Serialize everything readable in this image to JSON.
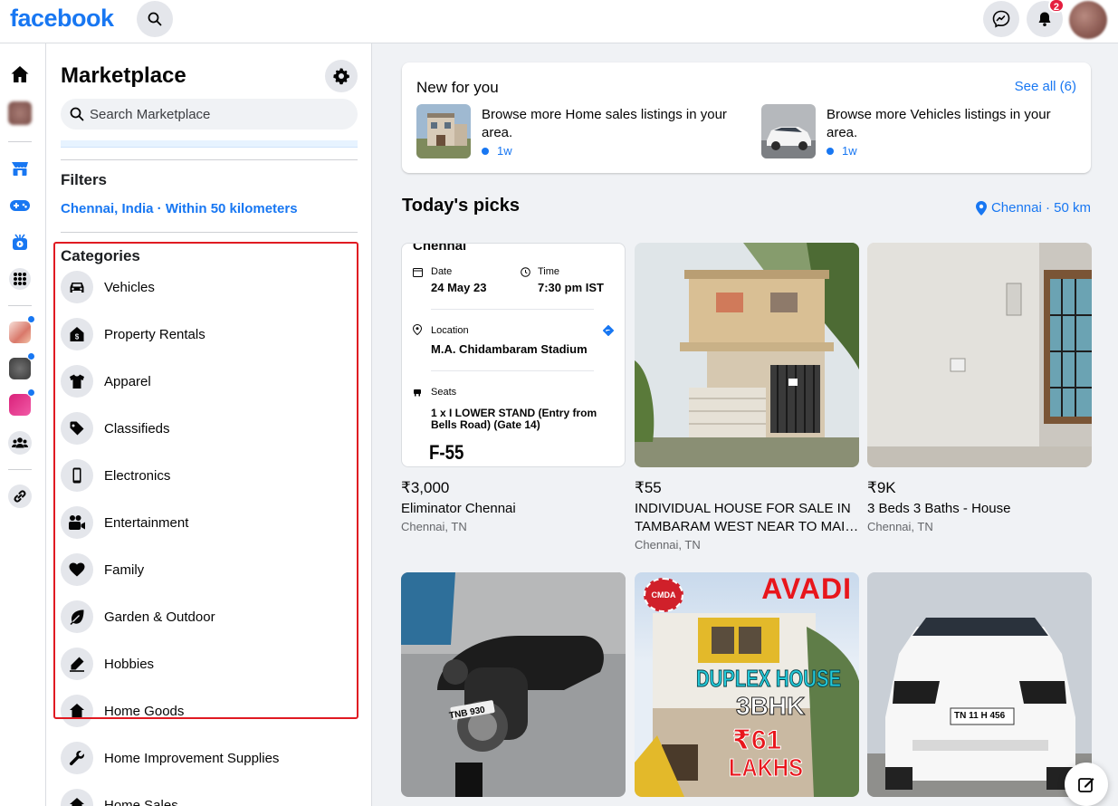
{
  "header": {
    "logo": "facebook",
    "notification_count": "2"
  },
  "sidebar": {
    "title": "Marketplace",
    "search_placeholder": "Search Marketplace",
    "filters_heading": "Filters",
    "filters_location": "Chennai, India · Within 50 kilometers",
    "categories_heading": "Categories",
    "categories": [
      {
        "label": "Vehicles",
        "icon": "car-icon"
      },
      {
        "label": "Property Rentals",
        "icon": "house-dollar-icon"
      },
      {
        "label": "Apparel",
        "icon": "shirt-icon"
      },
      {
        "label": "Classifieds",
        "icon": "tag-icon"
      },
      {
        "label": "Electronics",
        "icon": "phone-icon"
      },
      {
        "label": "Entertainment",
        "icon": "video-camera-icon"
      },
      {
        "label": "Family",
        "icon": "heart-icon"
      },
      {
        "label": "Garden & Outdoor",
        "icon": "leaf-icon"
      },
      {
        "label": "Hobbies",
        "icon": "pencil-icon"
      },
      {
        "label": "Home Goods",
        "icon": "house-icon"
      },
      {
        "label": "Home Improvement Supplies",
        "icon": "wrench-icon"
      },
      {
        "label": "Home Sales",
        "icon": "house-icon"
      }
    ]
  },
  "new_for_you": {
    "title": "New for you",
    "see_all": "See all (6)",
    "items": [
      {
        "text": "Browse more Home sales listings in your area.",
        "time": "1w"
      },
      {
        "text": "Browse more Vehicles listings in your area.",
        "time": "1w"
      }
    ]
  },
  "picks": {
    "title": "Today's picks",
    "location": "Chennai · 50 km",
    "ticket": {
      "city": "Chennai",
      "date_label": "Date",
      "date_value": "24 May 23",
      "time_label": "Time",
      "time_value": "7:30 pm IST",
      "location_label": "Location",
      "location_value": "M.A. Chidambaram Stadium",
      "seats_label": "Seats",
      "seats_value": "1 x I LOWER STAND (Entry from Bells Road) (Gate 14)",
      "seat_code": "F-55"
    },
    "listings": [
      {
        "price": "₹3,000",
        "title": "Eliminator Chennai",
        "location": "Chennai, TN"
      },
      {
        "price": "₹55",
        "title": "INDIVIDUAL HOUSE FOR SALE IN TAMBARAM WEST NEAR TO MAIN ROAD",
        "location": "Chennai, TN"
      },
      {
        "price": "₹9K",
        "title": "3 Beds 3 Baths - House",
        "location": "Chennai, TN"
      }
    ],
    "house_ad": {
      "area": "AVADI",
      "badge": "CMDA",
      "line1": "DUPLEX HOUSE",
      "line2": "3BHK",
      "line3": "₹61",
      "line4": "LAKHS"
    },
    "plates": {
      "bike": "TNB 930",
      "car": "TN 11 H 456"
    }
  }
}
